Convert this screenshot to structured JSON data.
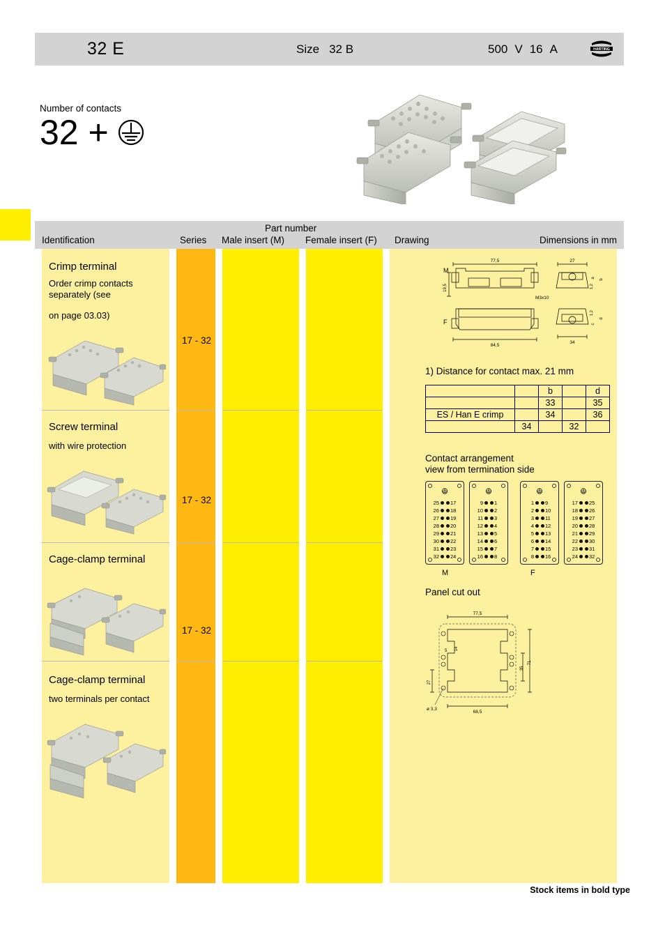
{
  "header": {
    "code": "32 E",
    "size_label": "Size",
    "size_value": "32 B",
    "voltage": "500",
    "voltage_unit": "V",
    "current": "16",
    "current_unit": "A",
    "brand": "HARTING"
  },
  "contacts": {
    "label": "Number of contacts",
    "count": "32 +",
    "earth_icon": "protective-earth-icon"
  },
  "table": {
    "headers": {
      "identification": "Identification",
      "series": "Series",
      "part_number": "Part number",
      "male_insert": "Male insert (M)",
      "female_insert": "Female insert (F)",
      "drawing": "Drawing",
      "dimensions": "Dimensions in mm"
    },
    "rows": [
      {
        "title": "Crimp terminal",
        "sub1": "Order crimp contacts\nseparately (see",
        "sub2": "on page 03.03)",
        "series": "17 - 32",
        "male": "",
        "female": ""
      },
      {
        "title": "Screw terminal",
        "sub1": "with wire protection",
        "sub2": "",
        "series": "17 - 32",
        "male": "",
        "female": ""
      },
      {
        "title": "Cage-clamp terminal",
        "sub1": "",
        "sub2": "",
        "series": "17 - 32",
        "male": "",
        "female": ""
      },
      {
        "title": "Cage-clamp terminal",
        "sub1": "two terminals per contact",
        "sub2": "",
        "series": "",
        "male": "",
        "female": ""
      }
    ]
  },
  "drawing": {
    "label_m": "M",
    "label_f": "F",
    "dim_width_top": "77,5",
    "dim_width_bottom": "84,5",
    "dim_height_left": "19,5",
    "dim_side_top": "27",
    "dim_side_bottom": "34",
    "thread": "M3x10",
    "dim_12_a": "1,2",
    "dim_12_b": "1,2",
    "letter_a": "a",
    "letter_b": "b",
    "letter_c": "c",
    "letter_d": "d",
    "footnote": "1) Distance for contact max. 21 mm"
  },
  "dim_table": {
    "rows": [
      [
        "",
        "",
        "b",
        "",
        "d"
      ],
      [
        "",
        "",
        "33",
        "",
        "35"
      ],
      [
        "ES / Han E   crimp",
        "",
        "34",
        "",
        "36"
      ],
      [
        "",
        "34",
        "",
        "32",
        ""
      ]
    ]
  },
  "contact_arrangement": {
    "title_line1": "Contact arrangement",
    "title_line2": "view from termination side",
    "label_m": "M",
    "label_f": "F",
    "blocks": [
      {
        "left": [
          "25",
          "26",
          "27",
          "28",
          "29",
          "30",
          "31",
          "32"
        ],
        "right": [
          "17",
          "18",
          "19",
          "20",
          "21",
          "22",
          "23",
          "24"
        ]
      },
      {
        "left": [
          "9",
          "10",
          "11",
          "12",
          "13",
          "14",
          "15",
          "16"
        ],
        "right": [
          "1",
          "2",
          "3",
          "4",
          "5",
          "6",
          "7",
          "8"
        ]
      },
      {
        "left": [
          "1",
          "2",
          "3",
          "4",
          "5",
          "6",
          "7",
          "8"
        ],
        "right": [
          "9",
          "10",
          "11",
          "12",
          "13",
          "14",
          "15",
          "16"
        ]
      },
      {
        "left": [
          "17",
          "18",
          "19",
          "20",
          "21",
          "22",
          "23",
          "24"
        ],
        "right": [
          "25",
          "26",
          "27",
          "28",
          "29",
          "30",
          "31",
          "32"
        ]
      }
    ]
  },
  "panel_cutout": {
    "title": "Panel cut out",
    "dim_top": "77,5",
    "dim_bottom": "68,5",
    "dim_left": "27",
    "dim_right_inner": "35",
    "dim_right_outer": "71",
    "dim_notch_w": "5",
    "dim_notch_h": "14",
    "hole_dia": "ø 3,3"
  },
  "footer": {
    "note": "Stock items in bold type"
  },
  "colors": {
    "header_grey": "#d3d3d3",
    "pale_yellow": "#fdf1a0",
    "bright_yellow": "#ffee00",
    "orange": "#ffb812",
    "tab_yellow": "#ffee00"
  }
}
